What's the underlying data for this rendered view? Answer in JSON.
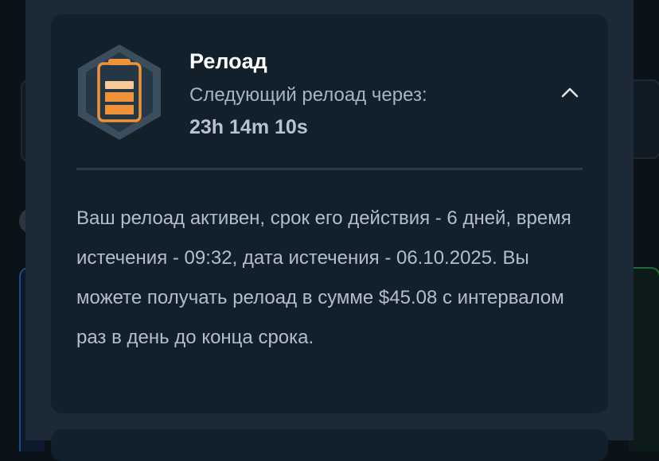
{
  "reload_card": {
    "icon": "battery-icon",
    "title": "Релоад",
    "subtitle": "Следующий релоад через:",
    "timer": "23h 14m 10s",
    "expanded": true,
    "description": "Ваш релоад активен, срок его действия - 6 дней, время истечения - 09:32, дата истечения - 06.10.2025. Вы можете получать релоад в сумме $45.08 с интервалом раз в день до конца срока."
  },
  "colors": {
    "modal_bg": "#1b2a36",
    "card_bg": "#12202b",
    "accent_orange": "#f0923a",
    "title": "#ffffff",
    "text_muted": "#a8b4bf"
  }
}
